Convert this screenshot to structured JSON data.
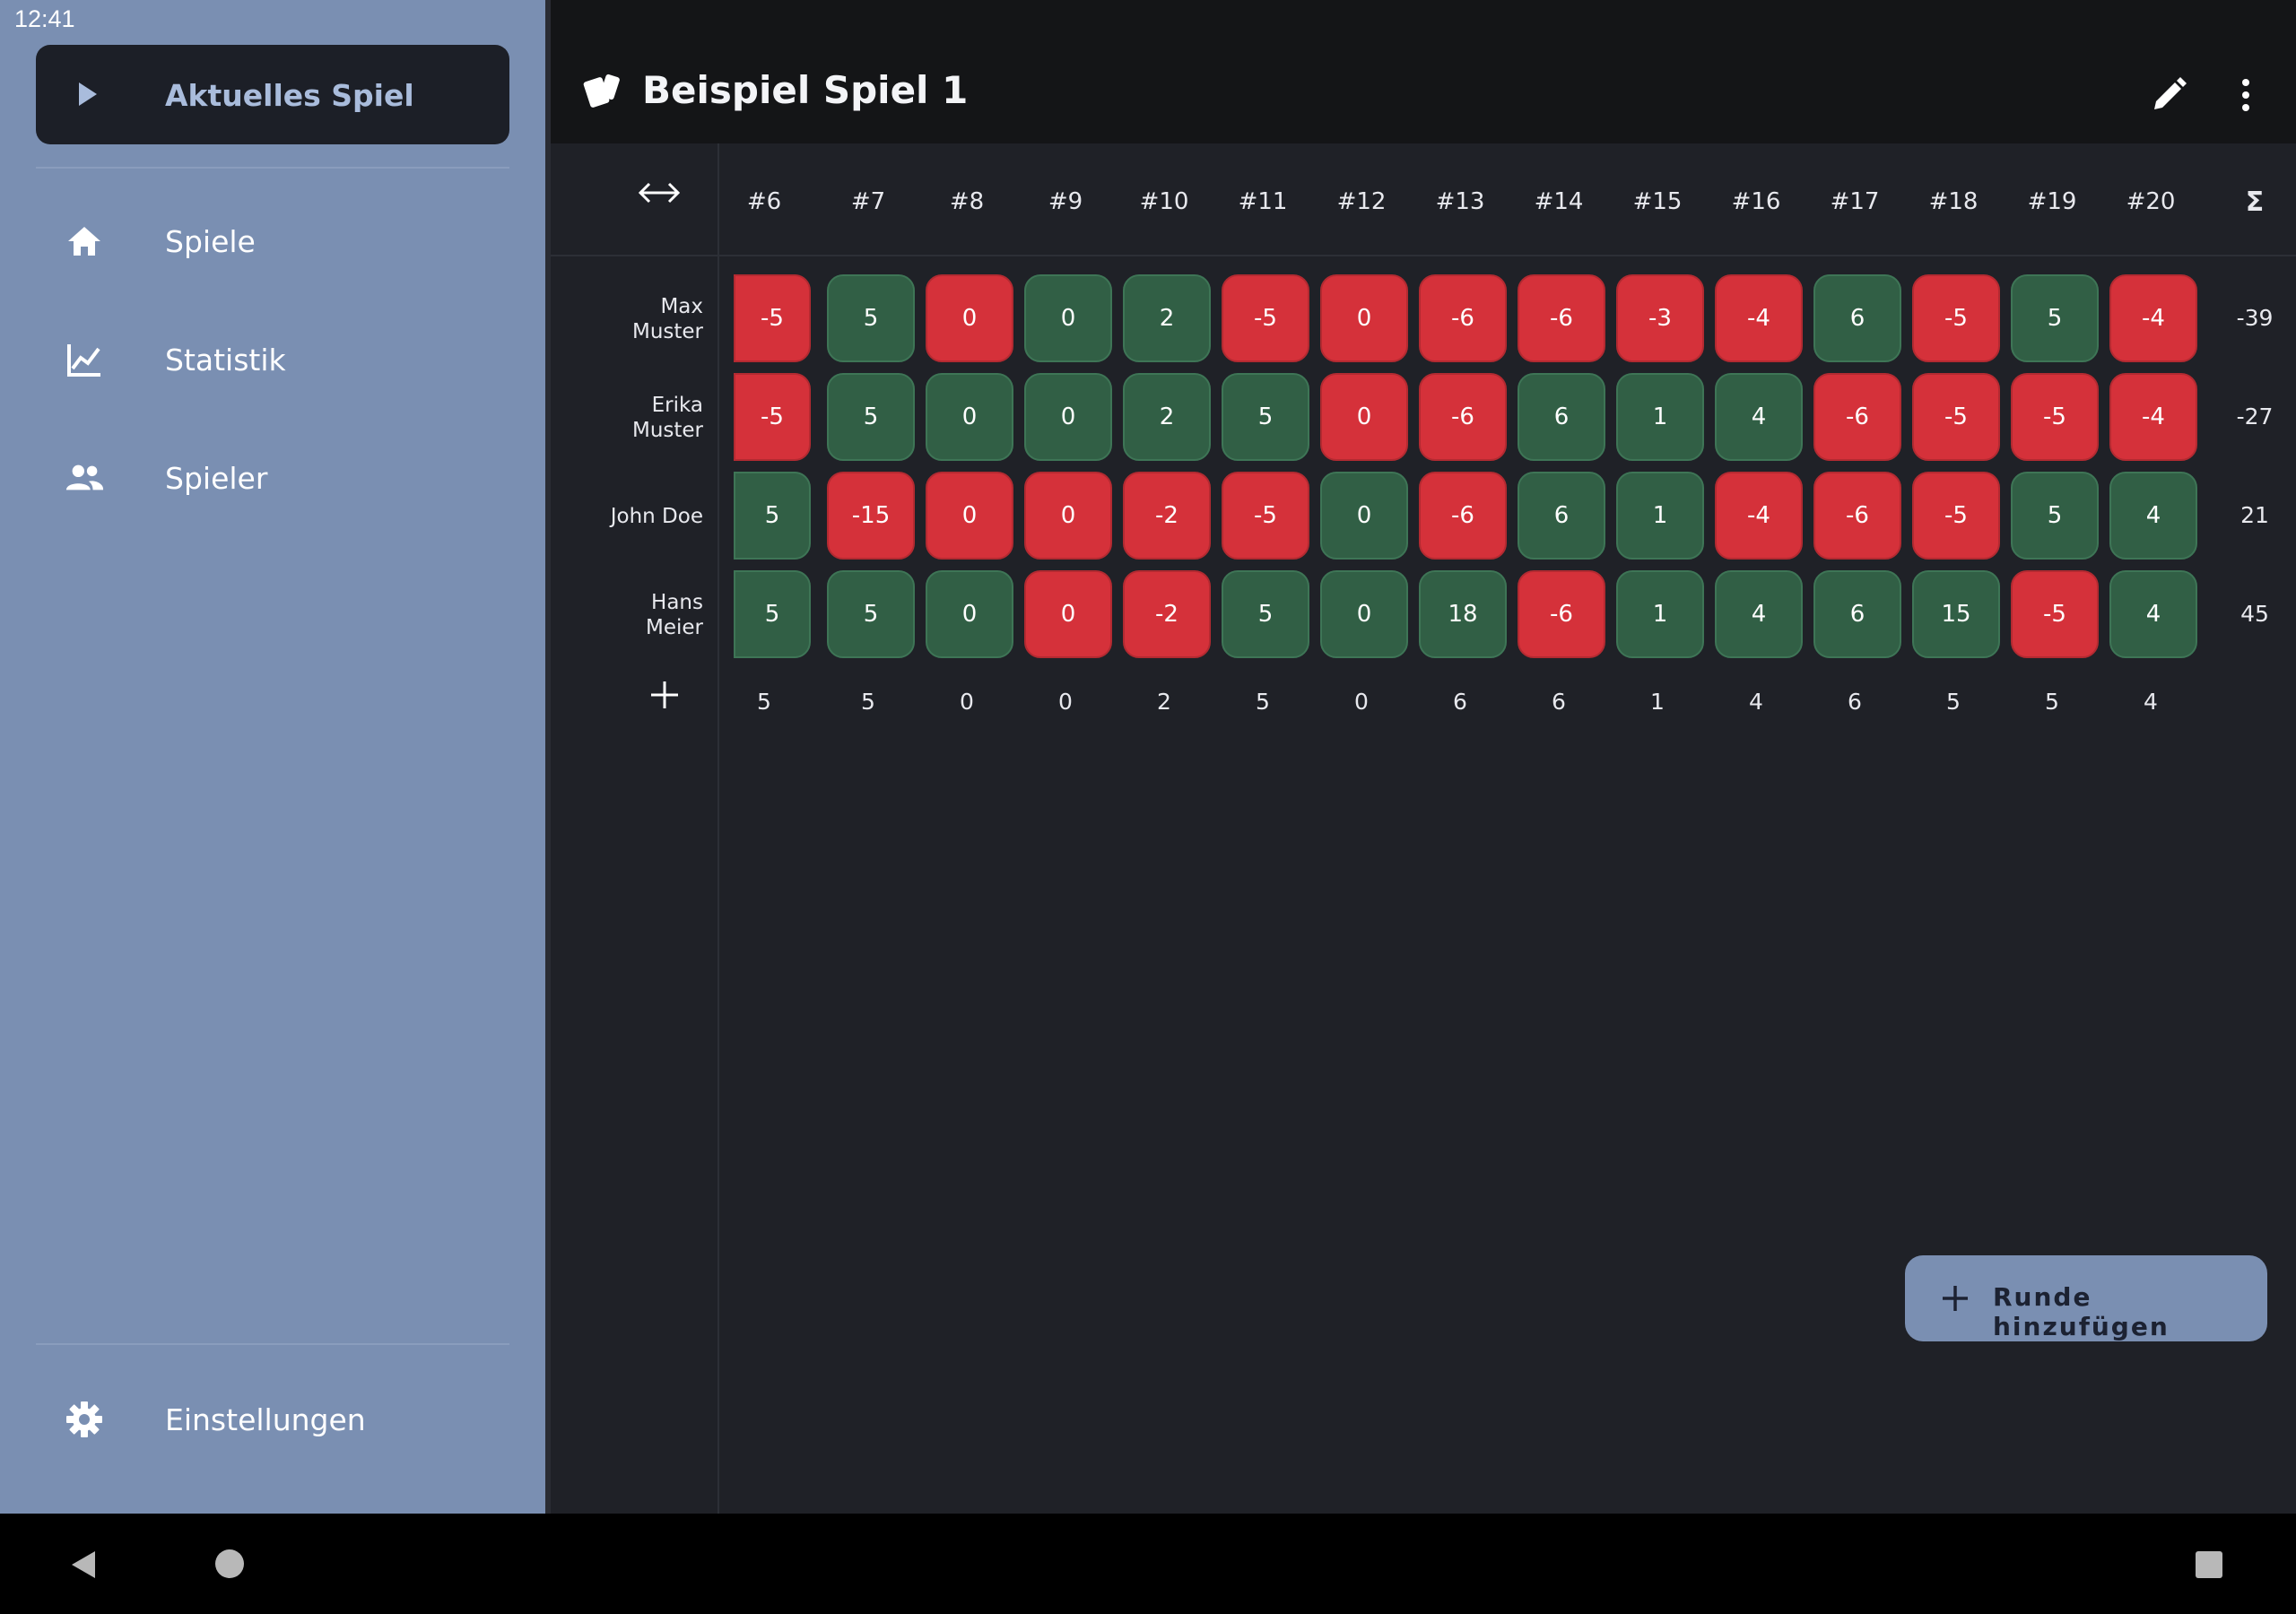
{
  "status": {
    "time": "12:41"
  },
  "sidebar": {
    "current_game_label": "Aktuelles Spiel",
    "items": [
      {
        "label": "Spiele",
        "icon": "home-icon"
      },
      {
        "label": "Statistik",
        "icon": "chart-icon"
      },
      {
        "label": "Spieler",
        "icon": "people-icon"
      }
    ],
    "settings_label": "Einstellungen"
  },
  "header": {
    "title": "Beispiel Spiel 1"
  },
  "table": {
    "rounds": [
      "#6",
      "#7",
      "#8",
      "#9",
      "#10",
      "#11",
      "#12",
      "#13",
      "#14",
      "#15",
      "#16",
      "#17",
      "#18",
      "#19",
      "#20"
    ],
    "sum_label": "Σ",
    "players": [
      {
        "name": "Max Muster",
        "scores": [
          "-5",
          "5",
          "0",
          "0",
          "2",
          "-5",
          "0",
          "-6",
          "-6",
          "-3",
          "-4",
          "6",
          "-5",
          "5",
          "-4"
        ],
        "signs": [
          "n",
          "p",
          "n",
          "p",
          "p",
          "n",
          "n",
          "n",
          "n",
          "n",
          "n",
          "p",
          "n",
          "p",
          "n"
        ],
        "total": "-39"
      },
      {
        "name": "Erika Muster",
        "scores": [
          "-5",
          "5",
          "0",
          "0",
          "2",
          "5",
          "0",
          "-6",
          "6",
          "1",
          "4",
          "-6",
          "-5",
          "-5",
          "-4"
        ],
        "signs": [
          "n",
          "p",
          "p",
          "p",
          "p",
          "p",
          "n",
          "n",
          "p",
          "p",
          "p",
          "n",
          "n",
          "n",
          "n"
        ],
        "total": "-27"
      },
      {
        "name": "John Doe",
        "scores": [
          "5",
          "-15",
          "0",
          "0",
          "-2",
          "-5",
          "0",
          "-6",
          "6",
          "1",
          "-4",
          "-6",
          "-5",
          "5",
          "4"
        ],
        "signs": [
          "p",
          "n",
          "n",
          "n",
          "n",
          "n",
          "p",
          "n",
          "p",
          "p",
          "n",
          "n",
          "n",
          "p",
          "p"
        ],
        "total": "21"
      },
      {
        "name": "Hans Meier",
        "scores": [
          "5",
          "5",
          "0",
          "0",
          "-2",
          "5",
          "0",
          "18",
          "-6",
          "1",
          "4",
          "6",
          "15",
          "-5",
          "4"
        ],
        "signs": [
          "p",
          "p",
          "p",
          "n",
          "n",
          "p",
          "p",
          "p",
          "n",
          "p",
          "p",
          "p",
          "p",
          "n",
          "p"
        ],
        "total": "45"
      }
    ],
    "footer": [
      "5",
      "5",
      "0",
      "0",
      "2",
      "5",
      "0",
      "6",
      "6",
      "1",
      "4",
      "6",
      "5",
      "5",
      "4"
    ]
  },
  "fab": {
    "label": "Runde hinzufügen"
  },
  "colors": {
    "negative": "#d5313a",
    "positive": "#315f45",
    "sidebar": "#7a8fb2",
    "background": "#1f2127"
  }
}
